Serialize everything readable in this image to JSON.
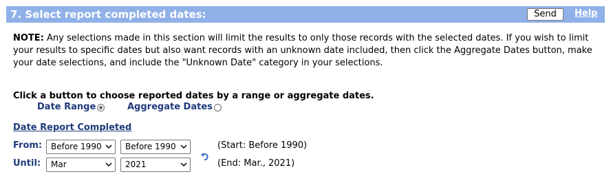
{
  "header": {
    "title": "7. Select report completed dates:",
    "send_label": "Send",
    "help_label": "Help",
    "background_color": "#8fb1e8"
  },
  "note": {
    "prefix": "NOTE:",
    "text": "Any selections made in this section will limit the results to only those records with the selected dates. If you wish to limit your results to specific dates but also want records with an unknown date included, then click the Aggregate Dates button, make your date selections, and include the \"Unknown Date\" category in your selections."
  },
  "date_mode": {
    "instruction": "Click a button to choose reported dates by a range or aggregate dates.",
    "options": [
      {
        "label": "Date Range",
        "checked": true
      },
      {
        "label": "Aggregate Dates",
        "checked": false
      }
    ]
  },
  "date_report": {
    "heading": "Date Report Completed",
    "from": {
      "label": "From:",
      "month": "Before 1990",
      "year": "Before 1990",
      "summary": "(Start: Before 1990)"
    },
    "until": {
      "label": "Until:",
      "month": "Mar",
      "year": "2021",
      "summary": "(End: Mar., 2021)"
    },
    "reset_icon": "undo-arrow-icon"
  },
  "colors": {
    "label_blue": "#1f3a7a",
    "header_blue": "#8fb1e8"
  }
}
